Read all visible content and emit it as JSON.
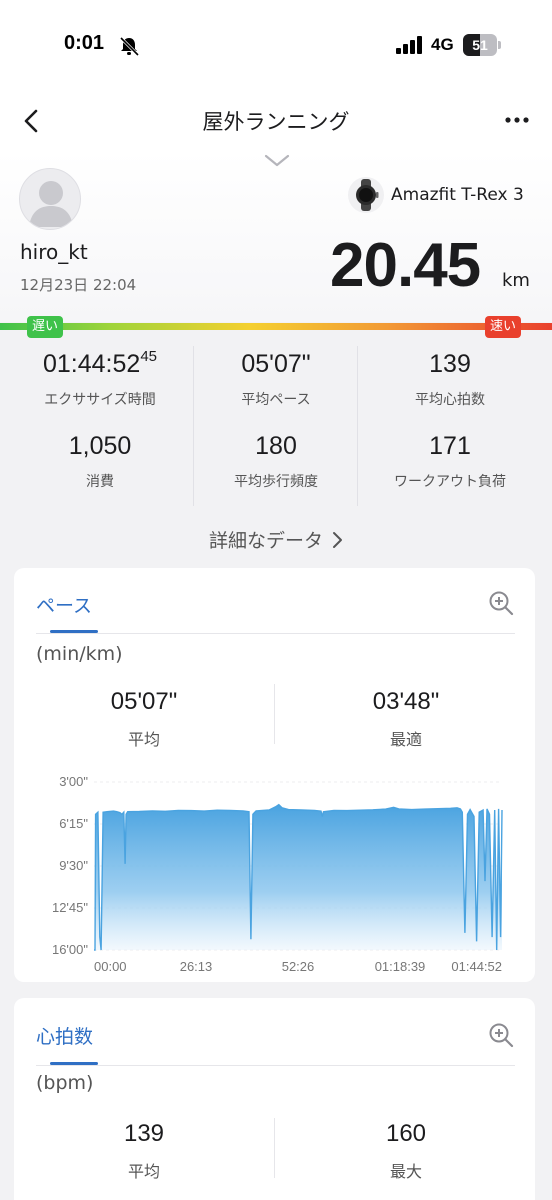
{
  "status_bar": {
    "time": "0:01",
    "network": "4G",
    "battery": "51",
    "battery_level": 0.51,
    "icons": [
      "bell-slash-icon",
      "signal-icon",
      "battery-icon"
    ]
  },
  "nav": {
    "title": "屋外ランニング",
    "icons": [
      "chevron-left-icon",
      "more-icon"
    ]
  },
  "summary": {
    "username": "hiro_kt",
    "date": "12月23日 22:04",
    "device": "Amazfit T-Rex 3",
    "distance": "20.45",
    "distance_unit": "km",
    "speed_slow_label": "遅い",
    "speed_fast_label": "速い"
  },
  "stats": [
    {
      "value": "01:44:52",
      "value_sup": "45",
      "label": "エクササイズ時間"
    },
    {
      "value": "05'07\"",
      "label": "平均ペース"
    },
    {
      "value": "139",
      "label": "平均心拍数"
    },
    {
      "value": "1,050",
      "label": "消費"
    },
    {
      "value": "180",
      "label": "平均歩行頻度"
    },
    {
      "value": "171",
      "label": "ワークアウト負荷"
    }
  ],
  "details_link": "詳細なデータ",
  "pace_card": {
    "title": "ペース",
    "unit": "(min/km)",
    "avg_value": "05'07\"",
    "avg_label": "平均",
    "best_value": "03'48\"",
    "best_label": "最適"
  },
  "hr_card": {
    "title": "心拍数",
    "unit": "(bpm)",
    "avg_value": "139",
    "avg_label": "平均",
    "max_value": "160",
    "max_label": "最大"
  },
  "colors": {
    "accent": "#2f6fc4",
    "chart_fill": "#4aa3e0",
    "speed_slow": "#3fc24a",
    "speed_fast": "#e9402d"
  },
  "chart_data": {
    "type": "area",
    "ylabel": "(min/km)",
    "y_ticks": [
      "3'00\"",
      "6'15\"",
      "9'30\"",
      "12'45\"",
      "16'00\""
    ],
    "x_ticks": [
      "00:00",
      "26:13",
      "52:26",
      "01:18:39",
      "01:44:52"
    ],
    "y_range_seconds": [
      180,
      960
    ],
    "y_inverted": true,
    "x_range_seconds": [
      0,
      6292
    ],
    "base_pace_seconds": 307,
    "points": [
      [
        0,
        960
      ],
      [
        15,
        960
      ],
      [
        25,
        330
      ],
      [
        60,
        320
      ],
      [
        90,
        900
      ],
      [
        110,
        960
      ],
      [
        140,
        320
      ],
      [
        200,
        318
      ],
      [
        300,
        315
      ],
      [
        350,
        318
      ],
      [
        400,
        322
      ],
      [
        430,
        330
      ],
      [
        460,
        320
      ],
      [
        480,
        560
      ],
      [
        495,
        330
      ],
      [
        520,
        318
      ],
      [
        700,
        317
      ],
      [
        900,
        314
      ],
      [
        1100,
        316
      ],
      [
        1300,
        312
      ],
      [
        1500,
        313
      ],
      [
        1700,
        315
      ],
      [
        1900,
        311
      ],
      [
        2100,
        312
      ],
      [
        2300,
        314
      ],
      [
        2390,
        318
      ],
      [
        2420,
        910
      ],
      [
        2450,
        330
      ],
      [
        2500,
        314
      ],
      [
        2700,
        310
      ],
      [
        2800,
        295
      ],
      [
        2850,
        285
      ],
      [
        2900,
        300
      ],
      [
        3000,
        308
      ],
      [
        3200,
        310
      ],
      [
        3400,
        312
      ],
      [
        3500,
        315
      ],
      [
        3520,
        340
      ],
      [
        3540,
        318
      ],
      [
        3700,
        312
      ],
      [
        3900,
        313
      ],
      [
        4100,
        311
      ],
      [
        4300,
        309
      ],
      [
        4500,
        306
      ],
      [
        4620,
        298
      ],
      [
        4700,
        305
      ],
      [
        4900,
        308
      ],
      [
        5100,
        306
      ],
      [
        5300,
        304
      ],
      [
        5500,
        302
      ],
      [
        5600,
        300
      ],
      [
        5650,
        305
      ],
      [
        5680,
        320
      ],
      [
        5720,
        880
      ],
      [
        5760,
        330
      ],
      [
        5800,
        308
      ],
      [
        5860,
        340
      ],
      [
        5900,
        920
      ],
      [
        5940,
        320
      ],
      [
        6000,
        310
      ],
      [
        6030,
        640
      ],
      [
        6060,
        305
      ],
      [
        6100,
        330
      ],
      [
        6140,
        900
      ],
      [
        6180,
        310
      ],
      [
        6210,
        960
      ],
      [
        6240,
        305
      ],
      [
        6270,
        900
      ],
      [
        6292,
        310
      ]
    ]
  }
}
